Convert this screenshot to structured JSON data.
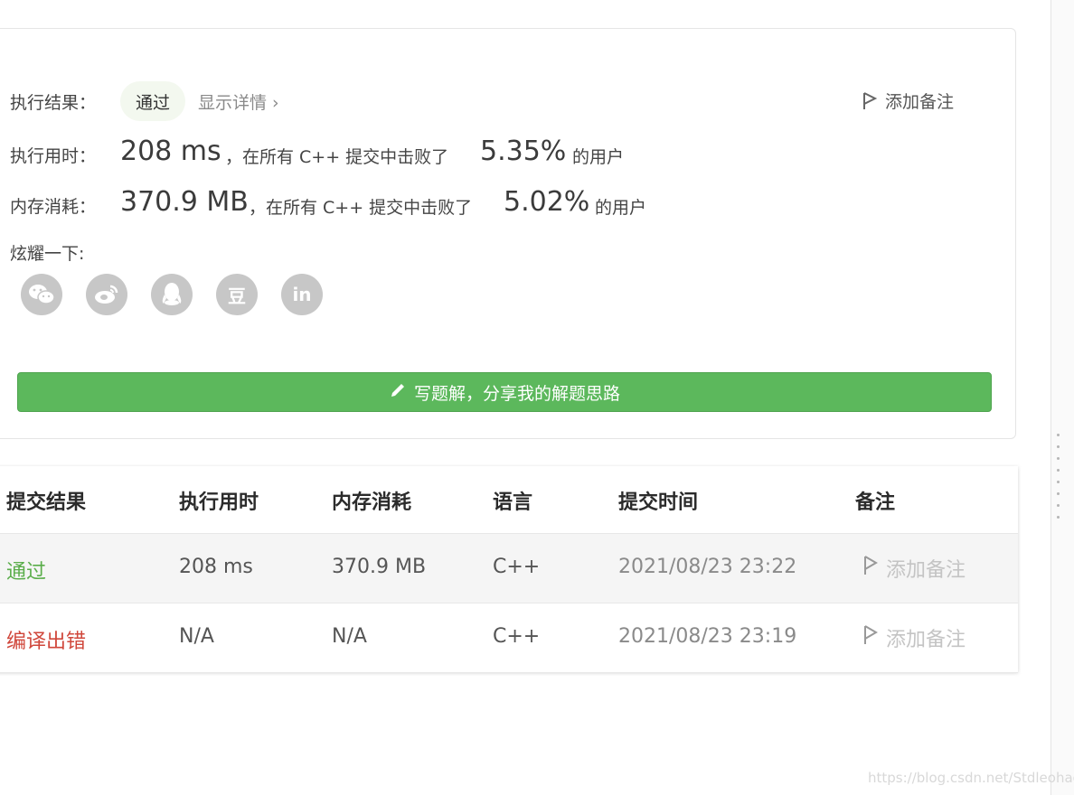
{
  "result": {
    "label": "执行结果：",
    "status": "通过",
    "details_link": "显示详情 ›",
    "add_note": "添加备注"
  },
  "runtime": {
    "label": "执行用时：",
    "value": "208 ms",
    "beat_text": "，在所有 C++ 提交中击败了",
    "percent": "5.35%",
    "suffix": "的用户"
  },
  "memory": {
    "label": "内存消耗：",
    "value": "370.9 MB",
    "beat_text": "，在所有 C++ 提交中击败了",
    "percent": "5.02%",
    "suffix": "的用户"
  },
  "share": {
    "label": "炫耀一下:",
    "icons": [
      "wechat-icon",
      "weibo-icon",
      "qq-icon",
      "douban-icon",
      "linkedin-icon"
    ],
    "douban_glyph": "豆",
    "linkedin_glyph": "in"
  },
  "solution_button": {
    "label": "写题解，分享我的解题思路"
  },
  "table": {
    "headers": [
      "提交结果",
      "执行用时",
      "内存消耗",
      "语言",
      "提交时间",
      "备注"
    ],
    "rows": [
      {
        "status": "通过",
        "runtime": "208 ms",
        "memory": "370.9 MB",
        "language": "C++",
        "time": "2021/08/23 23:22",
        "note": "添加备注"
      },
      {
        "status": "编译出错",
        "runtime": "N/A",
        "memory": "N/A",
        "language": "C++",
        "time": "2021/08/23 23:19",
        "note": "添加备注"
      }
    ]
  },
  "colors": {
    "accent_green": "#5cb85c",
    "pass_green": "#5aad4a",
    "error_red": "#d0473b"
  },
  "watermark": "https://blog.csdn.net/Stdleohao"
}
